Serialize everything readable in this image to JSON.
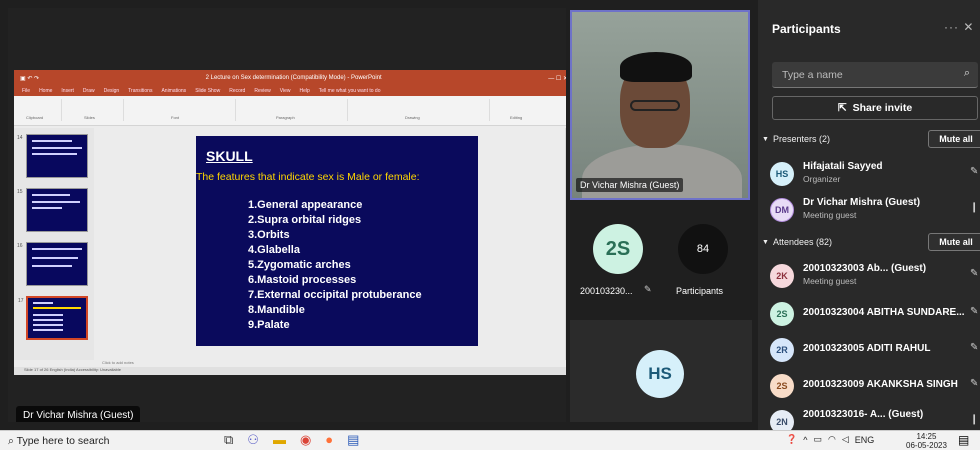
{
  "share": {
    "presenter_label": "Dr Vichar Mishra (Guest)",
    "ppt": {
      "title": "2 Lecture on Sex determination (Compatibility Mode) - PowerPoint",
      "menu": [
        "File",
        "Home",
        "Insert",
        "Draw",
        "Design",
        "Transitions",
        "Animations",
        "Slide Show",
        "Record",
        "Review",
        "View",
        "Help",
        "Tell me what you want to do"
      ],
      "ribbon_groups": [
        "Clipboard",
        "Slides",
        "Font",
        "Paragraph",
        "Drawing",
        "Editing"
      ],
      "thumb_numbers": [
        "14",
        "15",
        "16",
        "17"
      ],
      "notes": "Click to add notes",
      "status": "Slide 17 of 26   English (India)   Accessibility: Unavailable"
    },
    "slide": {
      "title": "SKULL",
      "subtitle": "The features that indicate sex is Male or female:",
      "items": [
        "1.General appearance",
        "2.Supra orbital ridges",
        "3.Orbits",
        "4.Glabella",
        "5.Zygomatic arches",
        "6.Mastoid processes",
        "7.External occipital protuberance",
        "8.Mandible",
        "9.Palate"
      ]
    }
  },
  "video": {
    "name": "Dr Vichar Mishra (Guest)"
  },
  "tiles": {
    "student": {
      "initials": "2S",
      "label": "200103230...",
      "mic": "🎤̸"
    },
    "participants": {
      "count": "84",
      "label": "Participants"
    },
    "hs": {
      "initials": "HS"
    }
  },
  "panel": {
    "title": "Participants",
    "controls": "··· ✕",
    "search_placeholder": "Type a name",
    "share_invite": "Share invite",
    "presenters_label": "Presenters (2)",
    "attendees_label": "Attendees (82)",
    "mute_all": "Mute all",
    "presenters": [
      {
        "initials": "HS",
        "name": "Hifajatali Sayyed",
        "role": "Organizer",
        "bg": "#d6f0fa",
        "fg": "#1c5a78"
      },
      {
        "initials": "DM",
        "name": "Dr Vichar Mishra (Guest)",
        "role": "Meeting guest",
        "bg": "#e8dcf6",
        "fg": "#5b3b8b"
      }
    ],
    "attendees": [
      {
        "initials": "2K",
        "name": "20010323003 Ab... (Guest)",
        "role": "Meeting guest",
        "bg": "#f6d8dc",
        "fg": "#8b2f3b"
      },
      {
        "initials": "2S",
        "name": "20010323004 ABITHA SUNDARE...",
        "role": "",
        "bg": "#cdf2e2",
        "fg": "#2a6f56"
      },
      {
        "initials": "2R",
        "name": "20010323005 ADITI RAHUL",
        "role": "",
        "bg": "#d6e6fa",
        "fg": "#2b4f7d"
      },
      {
        "initials": "2S",
        "name": "20010323009 AKANKSHA SINGH",
        "role": "",
        "bg": "#f8dcc8",
        "fg": "#8a4a1e"
      },
      {
        "initials": "2N",
        "name": "20010323016- A... (Guest)",
        "role": "",
        "bg": "#e6ecf5",
        "fg": "#3a4c6a"
      }
    ]
  },
  "taskbar": {
    "search": "Type here to search",
    "lang": "ENG",
    "time": "14:25",
    "date": "06-05-2023"
  }
}
